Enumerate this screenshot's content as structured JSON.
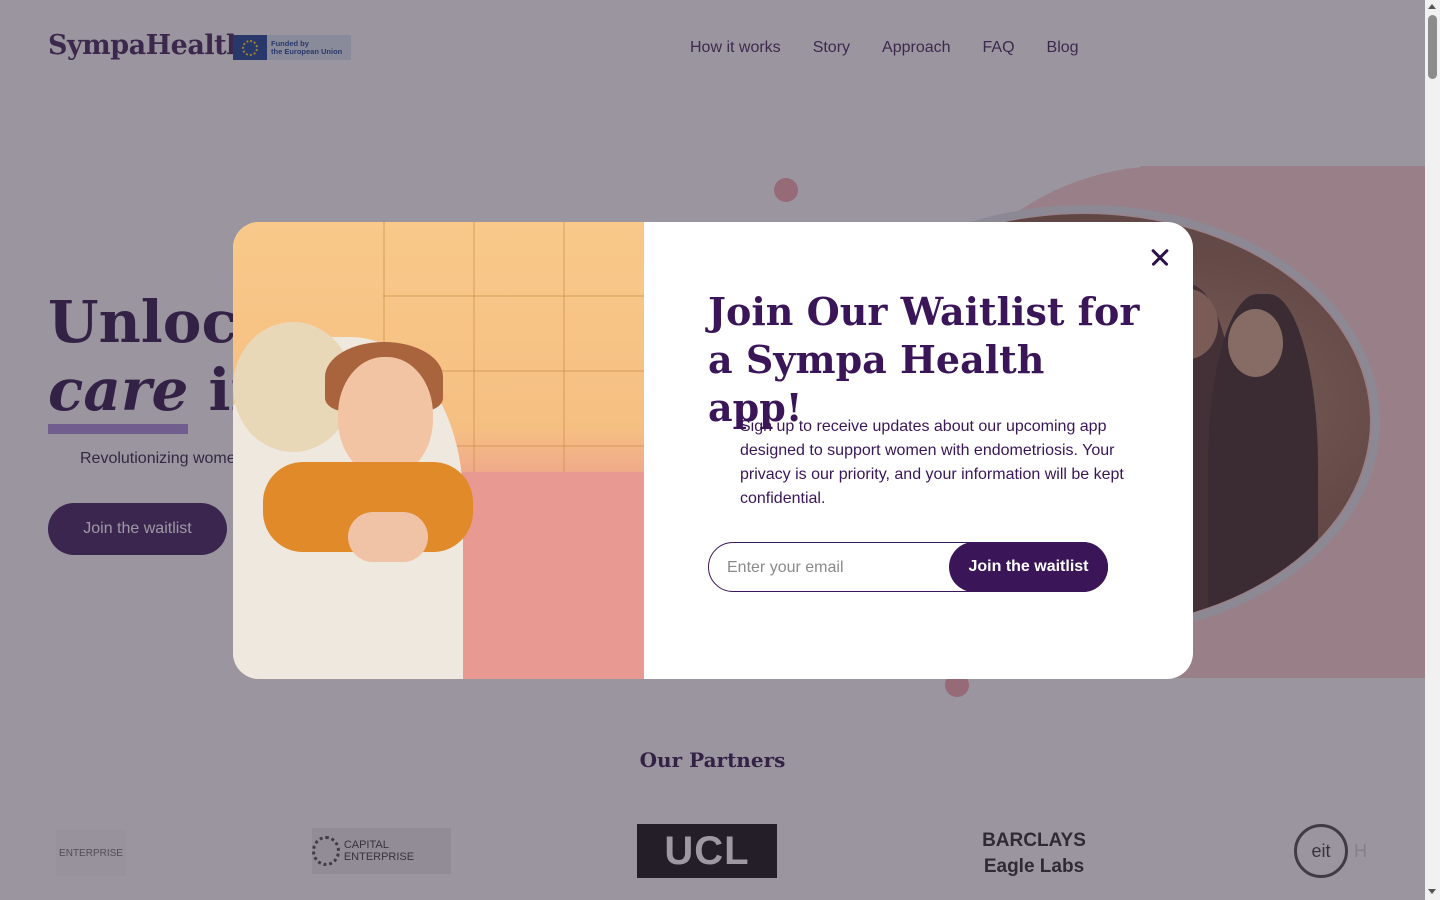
{
  "header": {
    "logo": "SympaHealth",
    "eu_badge": {
      "line1": "Funded by",
      "line2": "the European Union"
    },
    "nav": [
      "How it works",
      "Story",
      "Approach",
      "FAQ",
      "Blog"
    ]
  },
  "hero": {
    "title_line1": "Unlock",
    "title_line2_italic": "care",
    "title_line2_rest": " in e",
    "subtitle": "Revolutionizing women",
    "cta": "Join the waitlist"
  },
  "partners": {
    "title": "Our Partners",
    "logos": {
      "enterprise_partial": "ENTERPRISE",
      "capital_enterprise": "CAPITAL ENTERPRISE",
      "ucl": "UCL",
      "barclays_line1": "BARCLAYS",
      "barclays_line2": "Eagle Labs",
      "eit": "eit",
      "eit_suffix": "H"
    }
  },
  "modal": {
    "title": "Join Our Waitlist for a Sympa Health app!",
    "description": "Sign up to receive updates about our upcoming app designed to support women with endometriosis. Your privacy is our priority, and your information will be kept confidential.",
    "email_placeholder": "Enter your email",
    "submit_label": "Join the waitlist",
    "close_icon": "close-icon"
  },
  "colors": {
    "brand_purple": "#3a1658",
    "hero_pink": "#f7ccc8",
    "overlay": "rgba(60,50,70,0.5)"
  }
}
